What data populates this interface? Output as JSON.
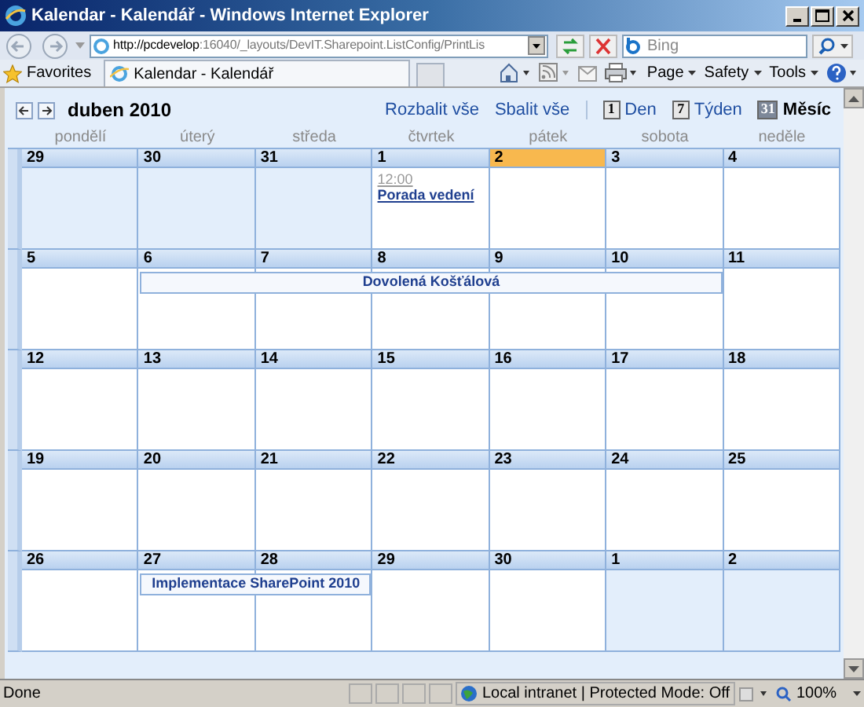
{
  "window": {
    "title": "Kalendar - Kalendář - Windows Internet Explorer"
  },
  "address_bar": {
    "url_host": "http://pcdevelop",
    "url_rest": ":16040/_layouts/DevIT.Sharepoint.ListConfig/PrintLis"
  },
  "search": {
    "placeholder": "Bing"
  },
  "favorites": {
    "label": "Favorites"
  },
  "tab": {
    "title": "Kalendar - Kalendář"
  },
  "command_bar": [
    "Page",
    "Safety",
    "Tools"
  ],
  "calendar": {
    "month": "duben 2010",
    "links": [
      "Rozbalit vše",
      "Sbalit vše"
    ],
    "views": [
      {
        "icon": "1",
        "label": "Den",
        "selected": false
      },
      {
        "icon": "7",
        "label": "Týden",
        "selected": false
      },
      {
        "icon": "31",
        "label": "Měsíc",
        "selected": true
      }
    ],
    "weekdays": [
      "pondělí",
      "úterý",
      "středa",
      "čtvrtek",
      "pátek",
      "sobota",
      "neděle"
    ],
    "weeks": [
      {
        "days": [
          {
            "number": "29",
            "in_month": false,
            "today": false
          },
          {
            "number": "30",
            "in_month": false,
            "today": false
          },
          {
            "number": "31",
            "in_month": false,
            "today": false
          },
          {
            "number": "1",
            "in_month": true,
            "today": false,
            "events": [
              {
                "time": "12:00",
                "title": "Porada vedení"
              }
            ]
          },
          {
            "number": "2",
            "in_month": true,
            "today": true
          },
          {
            "number": "3",
            "in_month": true,
            "today": false
          },
          {
            "number": "4",
            "in_month": true,
            "today": false
          }
        ]
      },
      {
        "banner": {
          "title": "Dovolená Košťálová"
        },
        "days": [
          {
            "number": "5",
            "in_month": true,
            "today": false,
            "in_banner": false
          },
          {
            "number": "6",
            "in_month": true,
            "today": false,
            "in_banner": true
          },
          {
            "number": "7",
            "in_month": true,
            "today": false,
            "in_banner": true
          },
          {
            "number": "8",
            "in_month": true,
            "today": false,
            "in_banner": true
          },
          {
            "number": "9",
            "in_month": true,
            "today": false,
            "in_banner": true
          },
          {
            "number": "10",
            "in_month": true,
            "today": false,
            "in_banner": true
          },
          {
            "number": "11",
            "in_month": true,
            "today": false,
            "in_banner": false
          }
        ]
      },
      {
        "days": [
          {
            "number": "12",
            "in_month": true,
            "today": false
          },
          {
            "number": "13",
            "in_month": true,
            "today": false
          },
          {
            "number": "14",
            "in_month": true,
            "today": false
          },
          {
            "number": "15",
            "in_month": true,
            "today": false
          },
          {
            "number": "16",
            "in_month": true,
            "today": false
          },
          {
            "number": "17",
            "in_month": true,
            "today": false
          },
          {
            "number": "18",
            "in_month": true,
            "today": false
          }
        ]
      },
      {
        "days": [
          {
            "number": "19",
            "in_month": true,
            "today": false
          },
          {
            "number": "20",
            "in_month": true,
            "today": false
          },
          {
            "number": "21",
            "in_month": true,
            "today": false
          },
          {
            "number": "22",
            "in_month": true,
            "today": false
          },
          {
            "number": "23",
            "in_month": true,
            "today": false
          },
          {
            "number": "24",
            "in_month": true,
            "today": false
          },
          {
            "number": "25",
            "in_month": true,
            "today": false
          }
        ]
      },
      {
        "banner": {
          "title": "Implementace SharePoint 2010"
        },
        "days": [
          {
            "number": "26",
            "in_month": true,
            "today": false,
            "in_banner": false
          },
          {
            "number": "27",
            "in_month": true,
            "today": false,
            "in_banner": true
          },
          {
            "number": "28",
            "in_month": true,
            "today": false,
            "in_banner": true
          },
          {
            "number": "29",
            "in_month": true,
            "today": false,
            "in_banner": false
          },
          {
            "number": "30",
            "in_month": true,
            "today": false,
            "in_banner": false
          },
          {
            "number": "1",
            "in_month": false,
            "today": false,
            "in_banner": false
          },
          {
            "number": "2",
            "in_month": false,
            "today": false,
            "in_banner": false
          }
        ]
      }
    ]
  },
  "status_bar": {
    "text": "Done",
    "zone": "Local intranet | Protected Mode: Off",
    "zoom": "100%"
  }
}
